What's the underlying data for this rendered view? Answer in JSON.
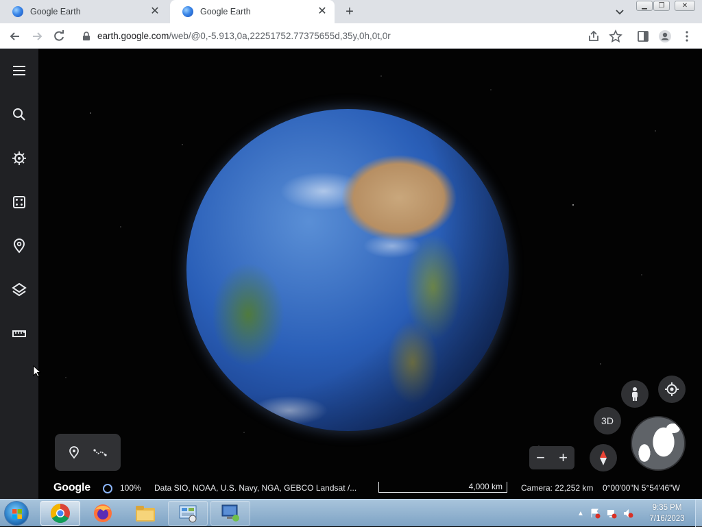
{
  "browser": {
    "tabs": [
      {
        "title": "Google Earth",
        "active": false
      },
      {
        "title": "Google Earth",
        "active": true
      }
    ],
    "new_tab": "+",
    "tab_close": "✕",
    "url_host": "earth.google.com",
    "url_path": "/web/@0,-5.913,0a,22251752.77375655d,35y,0h,0t,0r"
  },
  "sidebar": {
    "items": [
      {
        "icon": "menu-icon"
      },
      {
        "icon": "search-icon"
      },
      {
        "icon": "voyager-icon"
      },
      {
        "icon": "feeling-lucky-icon"
      },
      {
        "icon": "projects-icon"
      },
      {
        "icon": "map-style-icon"
      },
      {
        "icon": "measure-icon"
      }
    ]
  },
  "controls": {
    "btn_3d": "3D",
    "zoom_out": "−",
    "zoom_in": "+"
  },
  "status": {
    "logo": "Google",
    "progress": "100%",
    "attribution": "Data SIO, NOAA, U.S. Navy, NGA, GEBCO  Landsat /...",
    "scale_label": "4,000 km",
    "camera": "Camera: 22,252 km",
    "coords": "0°00'00\"N 5°54'46\"W"
  },
  "taskbar": {
    "time": "9:35 PM",
    "date": "7/16/2023"
  },
  "colors": {
    "sidebar_bg": "#202124",
    "control_bg": "#303134",
    "accent": "#8ab4f8"
  }
}
